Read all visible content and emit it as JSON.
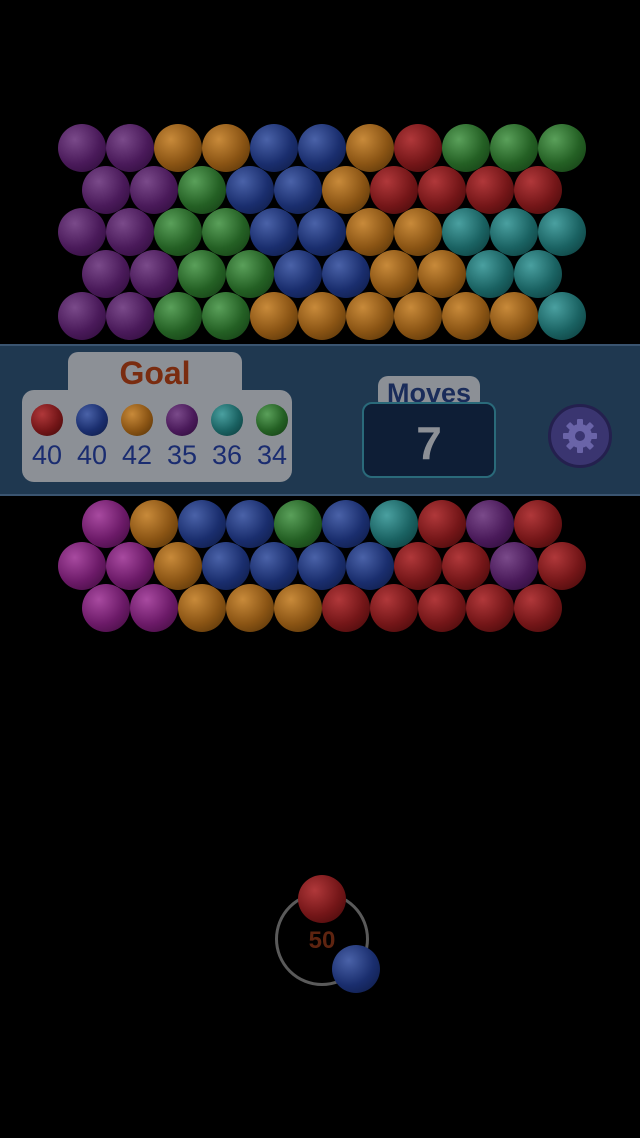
{
  "colors": {
    "purple": "#4a1a5a",
    "green": "#246024",
    "blue": "#1a2e6e",
    "orange": "#8a5414",
    "red": "#741618",
    "teal": "#1a6262",
    "magenta": "#6c1a68"
  },
  "board": {
    "top_rows": [
      [
        "purple",
        "purple",
        "orange",
        "orange",
        "blue",
        "blue",
        "orange",
        "red",
        "green",
        "green",
        "green"
      ],
      [
        "purple",
        "purple",
        "green",
        "blue",
        "blue",
        "orange",
        "red",
        "red",
        "red",
        "red"
      ],
      [
        "purple",
        "purple",
        "green",
        "green",
        "blue",
        "blue",
        "orange",
        "orange",
        "teal",
        "teal",
        "teal"
      ],
      [
        "purple",
        "purple",
        "green",
        "green",
        "blue",
        "blue",
        "orange",
        "orange",
        "teal",
        "teal"
      ],
      [
        "purple",
        "purple",
        "green",
        "green",
        "orange",
        "orange",
        "orange",
        "orange",
        "orange",
        "orange",
        "teal"
      ]
    ],
    "bottom_rows": [
      [
        "magenta",
        "orange",
        "blue",
        "blue",
        "green",
        "blue",
        "teal",
        "red",
        "purple",
        "red"
      ],
      [
        "magenta",
        "magenta",
        "orange",
        "blue",
        "blue",
        "blue",
        "blue",
        "red",
        "red",
        "purple",
        "red"
      ],
      [
        "magenta",
        "magenta",
        "orange",
        "orange",
        "orange",
        "red",
        "red",
        "red",
        "red",
        "red"
      ]
    ]
  },
  "hud": {
    "goal": {
      "title": "Goal",
      "items": [
        {
          "color": "red",
          "count": "40"
        },
        {
          "color": "blue",
          "count": "40"
        },
        {
          "color": "orange",
          "count": "42"
        },
        {
          "color": "purple",
          "count": "35"
        },
        {
          "color": "teal",
          "count": "36"
        },
        {
          "color": "green",
          "count": "34"
        }
      ]
    },
    "moves": {
      "label": "Moves",
      "value": "7"
    },
    "settings_icon": "gear-icon"
  },
  "shooter": {
    "current_color": "red",
    "next_color": "blue",
    "shots_left": "50"
  }
}
